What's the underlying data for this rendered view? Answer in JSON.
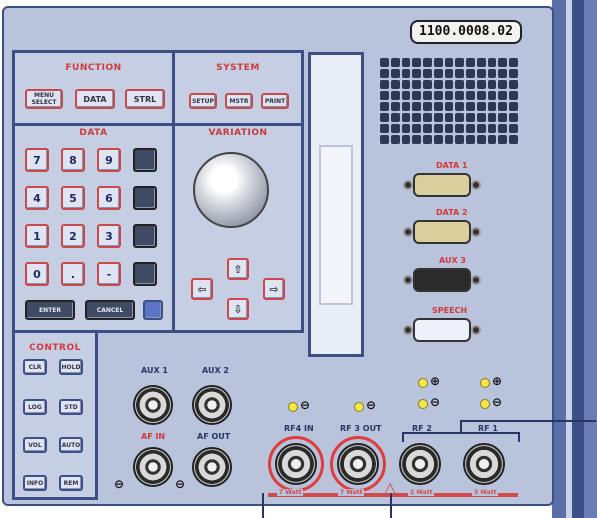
{
  "serial_number": "1100.0008.02",
  "sections": {
    "function": "FUNCTION",
    "system": "SYSTEM",
    "data": "DATA",
    "variation": "VARIATION",
    "control": "CONTROL"
  },
  "function_keys": [
    "MENU\nSELECT",
    "DATA",
    "STRL"
  ],
  "system_keys": [
    "SETUP",
    "MSTR",
    "PRINT"
  ],
  "data_keys": {
    "digits": [
      "7",
      "8",
      "9",
      "4",
      "5",
      "6",
      "1",
      "2",
      "3",
      "0",
      ".",
      "-"
    ],
    "bottom": [
      "ENTER",
      "CANCEL"
    ]
  },
  "control_keys": [
    "CLR",
    "HOLD",
    "LOG",
    "STD",
    "VOL",
    "AUTO",
    "INFO",
    "REM"
  ],
  "connectors": {
    "data1": "DATA 1",
    "data2": "DATA 2",
    "aux3": "AUX 3",
    "speech": "SPEECH",
    "aux1": "AUX 1",
    "aux2": "AUX 2",
    "af_in": "AF IN",
    "af_out": "AF OUT",
    "rf4_in": "RF4 IN",
    "rf3_out": "RF 3 OUT",
    "rf2": "RF 2",
    "rf1": "RF 1"
  },
  "ratings": [
    "7 Watt",
    "7 Watt",
    "2 Watt",
    "3 Watt"
  ],
  "colors": {
    "panel": "#b9c3dc",
    "frame": "#3c4f86",
    "accent": "#d24a4a"
  }
}
